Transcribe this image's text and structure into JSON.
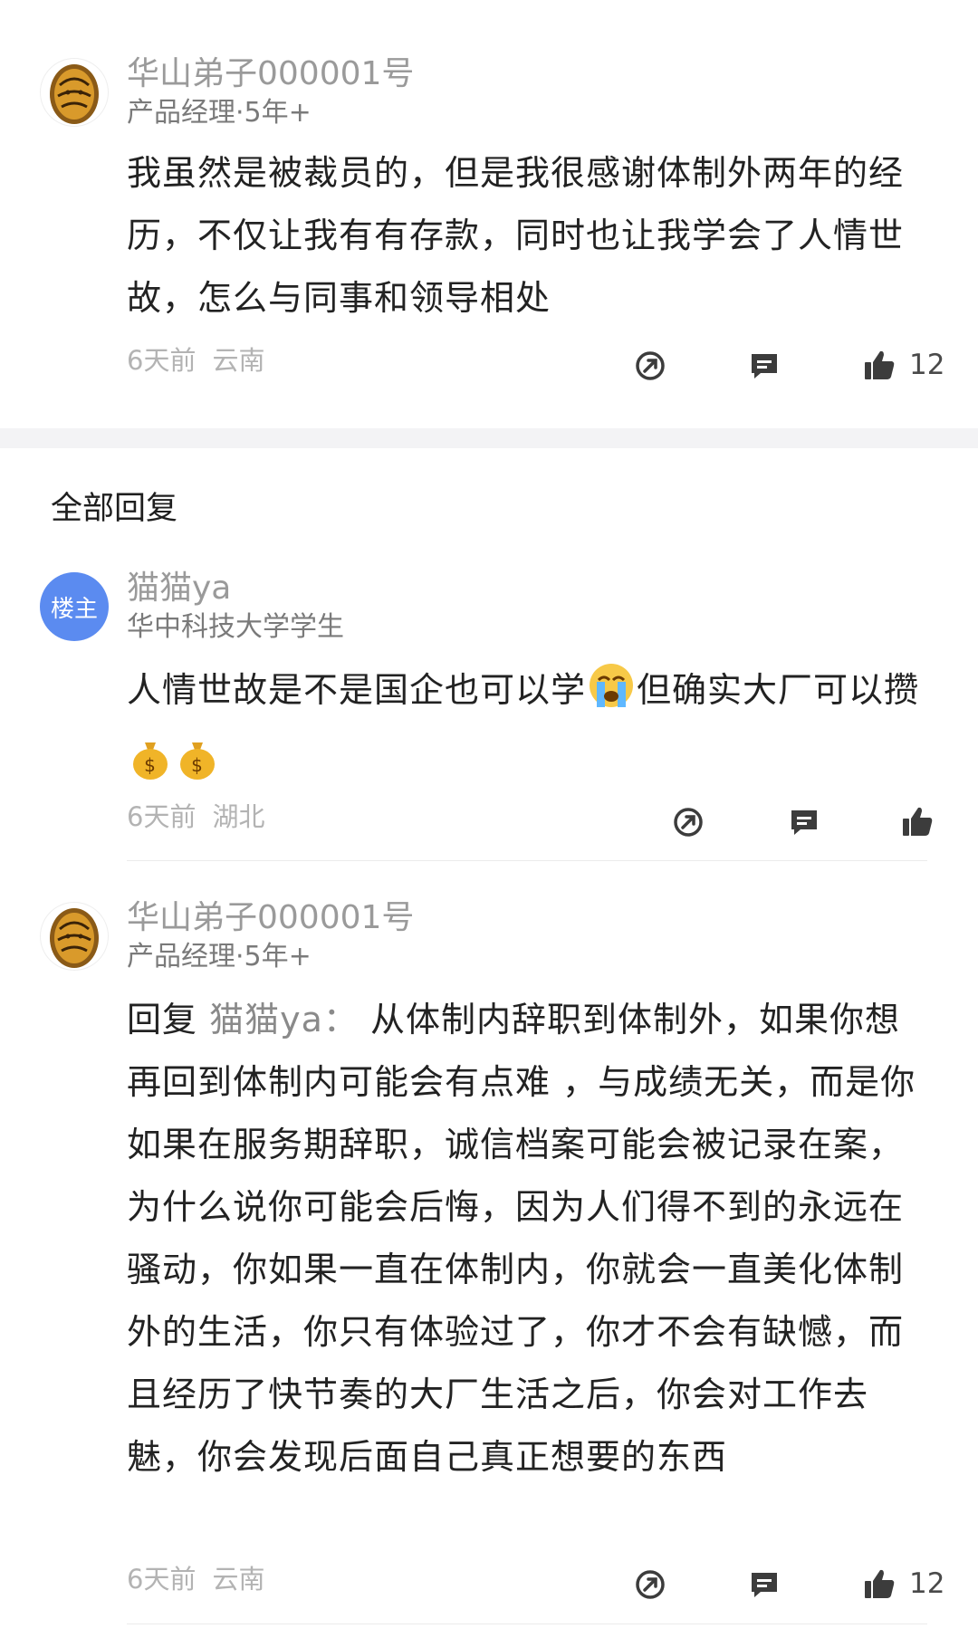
{
  "top_comment": {
    "author": "华山弟子000001号",
    "title": "产品经理·5年+",
    "content": "我虽然是被裁员的，但是我很感谢体制外两年的经历，不仅让我有有存款，同时也让我学会了人情世故，怎么与同事和领导相处",
    "time": "6天前",
    "location": "云南",
    "likes": "12"
  },
  "replies_section": {
    "title": "全部回复"
  },
  "replies": [
    {
      "author": "猫猫ya",
      "avatar_label": "楼主",
      "title": "华中科技大学学生",
      "content_part1": "人情世故是不是国企也可以学",
      "content_part2": "但确实大厂可以攒",
      "emojis": [
        "loudly-crying-face-emoji",
        "money-bag-emoji",
        "money-bag-emoji"
      ],
      "time": "6天前",
      "location": "湖北"
    },
    {
      "author": "华山弟子000001号",
      "title": "产品经理·5年+",
      "reply_prefix": "回复",
      "reply_to": "猫猫ya：",
      "content": "从体制内辞职到体制外，如果你想再回到体制内可能会有点难 ，与成绩无关，而是你如果在服务期辞职，诚信档案可能会被记录在案，为什么说你可能会后悔，因为人们得不到的永远在骚动，你如果一直在体制内，你就会一直美化体制外的生活，你只有体验过了，你才不会有缺憾，而且经历了快节奏的大厂生活之后，你会对工作去魅，你会发现后面自己真正想要的东西",
      "time": "6天前",
      "location": "云南",
      "likes": "12"
    }
  ],
  "icons": {
    "share": "share-icon",
    "comment": "comment-icon",
    "like": "thumbs-up-icon"
  }
}
